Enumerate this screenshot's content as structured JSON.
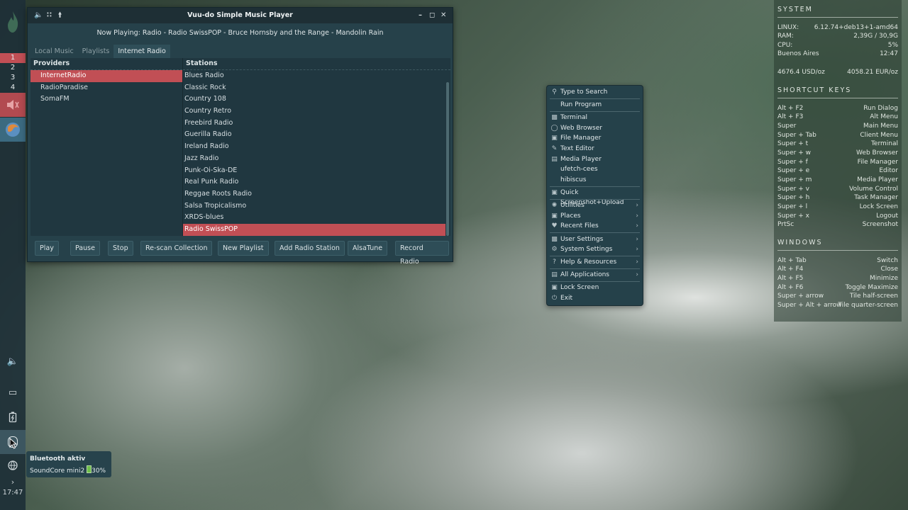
{
  "panel": {
    "workspaces": [
      "1",
      "2",
      "3",
      "4"
    ],
    "clock": "17:47",
    "expand_arrow": "›"
  },
  "player": {
    "title": "Vuu-do Simple Music Player",
    "now_playing": "Now Playing: Radio - Radio SwissPOP - Bruce Hornsby and the Range - Mandolin Rain",
    "tabs": [
      "Local Music",
      "Playlists",
      "Internet Radio"
    ],
    "providers_header": "Providers",
    "providers": [
      "InternetRadio",
      "RadioParadise",
      "SomaFM"
    ],
    "stations_header": "Stations",
    "stations": [
      "Blues Radio",
      "Classic Rock",
      "Country 108",
      "Country Retro",
      "Freebird Radio",
      "Guerilla Radio",
      "Ireland Radio",
      "Jazz Radio",
      "Punk-Oi-Ska-DE",
      "Real Punk Radio",
      "Reggae Roots Radio",
      "Salsa Tropicalismo",
      "XRDS-blues",
      "Radio SwissPOP"
    ],
    "buttons": [
      "Play",
      "Pause",
      "Stop",
      "Re-scan Collection",
      "New Playlist",
      "Add Radio Station",
      "AlsaTune",
      "Record Radio"
    ]
  },
  "menu": {
    "search": "Type to Search",
    "run": "Run Program",
    "apps": [
      "Terminal",
      "Web Browser",
      "File Manager",
      "Text Editor",
      "Media Player",
      "ufetch-cees",
      "hibiscus"
    ],
    "screenshot": "Quick Screenshot+Upload",
    "sub1": [
      "Utilities",
      "Places",
      "Recent Files"
    ],
    "sub2": [
      "User Settings",
      "System Settings"
    ],
    "help": "Help & Resources",
    "all_apps": "All Applications",
    "lock": "Lock Screen",
    "exit": "Exit"
  },
  "conky": {
    "system_title": "SYSTEM",
    "system": [
      {
        "k": "LINUX:",
        "v": "6.12.74+deb13+1-amd64"
      },
      {
        "k": "RAM:",
        "v": "2,39G / 30,9G"
      },
      {
        "k": "CPU:",
        "v": "5%"
      },
      {
        "k": "Buenos Aires",
        "v": "12:47"
      }
    ],
    "gold_usd": "4676.4 USD/oz",
    "gold_eur": "4058.21 EUR/oz",
    "shortcuts_title": "SHORTCUT KEYS",
    "shortcuts": [
      {
        "k": "Alt + F2",
        "v": "Run Dialog"
      },
      {
        "k": "Alt + F3",
        "v": "Alt Menu"
      },
      {
        "k": "Super",
        "v": "Main Menu"
      },
      {
        "k": "Super + Tab",
        "v": "Client Menu"
      },
      {
        "k": "Super + t",
        "v": "Terminal"
      },
      {
        "k": "Super + w",
        "v": "Web Browser"
      },
      {
        "k": "Super + f",
        "v": "File Manager"
      },
      {
        "k": "Super + e",
        "v": "Editor"
      },
      {
        "k": "Super + m",
        "v": "Media Player"
      },
      {
        "k": "Super + v",
        "v": "Volume Control"
      },
      {
        "k": "Super + h",
        "v": "Task Manager"
      },
      {
        "k": "Super + l",
        "v": "Lock Screen"
      },
      {
        "k": "Super + x",
        "v": "Logout"
      },
      {
        "k": "PrtSc",
        "v": "Screenshot"
      }
    ],
    "windows_title": "WINDOWS",
    "windows": [
      {
        "k": "Alt + Tab",
        "v": "Switch"
      },
      {
        "k": "Alt + F4",
        "v": "Close"
      },
      {
        "k": "Alt + F5",
        "v": "Minimize"
      },
      {
        "k": "Alt + F6",
        "v": "Toggle Maximize"
      },
      {
        "k": "Super + arrow",
        "v": "Tile half-screen"
      },
      {
        "k": "Super + Alt + arrow",
        "v": "Tile quarter-screen"
      }
    ]
  },
  "tooltip": {
    "title": "Bluetooth aktiv",
    "device": "SoundCore mini2",
    "battery": "30%"
  },
  "colors": {
    "accent": "#c14f55",
    "panel": "#26414a"
  }
}
